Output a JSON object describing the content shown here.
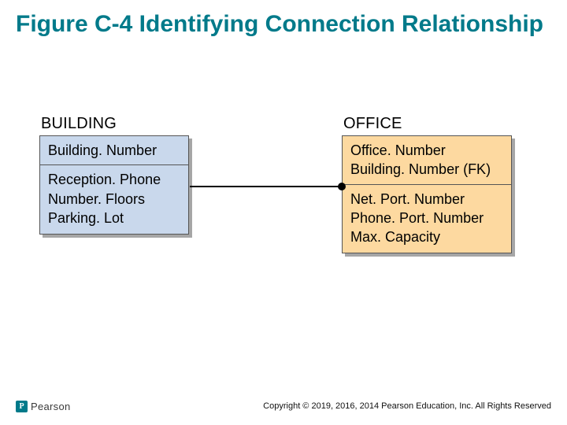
{
  "title": "Figure C-4 Identifying Connection Relationship",
  "entities": {
    "building": {
      "label": "BUILDING",
      "pk": [
        "Building. Number"
      ],
      "attrs": [
        "Reception. Phone",
        "Number. Floors",
        "Parking. Lot"
      ]
    },
    "office": {
      "label": "OFFICE",
      "pk": [
        "Office. Number",
        "Building. Number (FK)"
      ],
      "attrs": [
        "Net. Port. Number",
        "Phone. Port. Number",
        "Max. Capacity"
      ]
    }
  },
  "logo": {
    "mark": "P",
    "text": "Pearson"
  },
  "copyright": "Copyright © 2019, 2016, 2014 Pearson Education, Inc. All Rights Reserved"
}
